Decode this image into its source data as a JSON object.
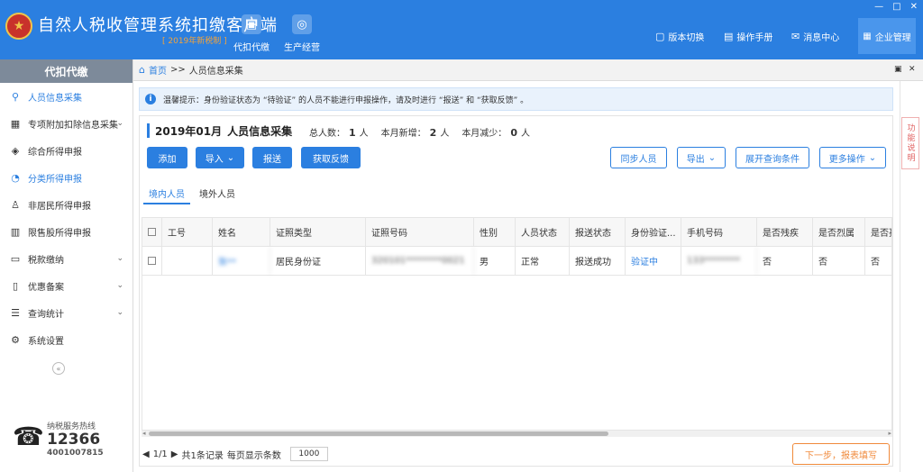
{
  "header": {
    "title": "自然人税收管理系统扣缴客户端",
    "subtitle": "[ 2019年新税制 ]",
    "modules": [
      {
        "label": "代扣代缴",
        "icon": "wallet-icon"
      },
      {
        "label": "生产经营",
        "icon": "coins-icon"
      }
    ],
    "menu": {
      "version": "版本切换",
      "manual": "操作手册",
      "messages": "消息中心",
      "enterprise": "企业管理"
    },
    "window_controls": [
      "—",
      "□",
      "✕"
    ]
  },
  "sidebar": {
    "title": "代扣代缴",
    "items": [
      {
        "label": "人员信息采集",
        "icon": "person-icon",
        "state": "active"
      },
      {
        "label": "专项附加扣除信息采集",
        "icon": "grid-icon",
        "state": "normal",
        "expandable": true
      },
      {
        "label": "综合所得申报",
        "icon": "layers-icon",
        "state": "normal"
      },
      {
        "label": "分类所得申报",
        "icon": "pie-icon",
        "state": "blue"
      },
      {
        "label": "非居民所得申报",
        "icon": "user-icon",
        "state": "normal"
      },
      {
        "label": "限售股所得申报",
        "icon": "bar-chart-icon",
        "state": "normal"
      },
      {
        "label": "税款缴纳",
        "icon": "wallet-icon",
        "state": "normal",
        "expandable": true
      },
      {
        "label": "优惠备案",
        "icon": "document-icon",
        "state": "normal",
        "expandable": true
      },
      {
        "label": "查询统计",
        "icon": "search-list-icon",
        "state": "normal",
        "expandable": true
      },
      {
        "label": "系统设置",
        "icon": "gear-icon",
        "state": "normal"
      }
    ],
    "hotline": {
      "label": "纳税服务热线",
      "number": "12366",
      "alt": "4001007815"
    }
  },
  "breadcrumb": {
    "home": "首页",
    "separator": ">>",
    "current": "人员信息采集"
  },
  "notice": {
    "text": "温馨提示：身份验证状态为 “待验证” 的人员不能进行申报操作，请及时进行 “报送” 和 “获取反馈” 。"
  },
  "side_tab": "功能说明",
  "panel": {
    "period": "2019年01月",
    "title": "人员信息采集",
    "stats": {
      "total_label": "总人数：",
      "total": "1",
      "new_label": "本月新增：",
      "new": "2",
      "reduce_label": "本月减少：",
      "reduce": "0",
      "unit": "人"
    },
    "buttons_left": {
      "add": "添加",
      "import": "导入",
      "submit": "报送",
      "feedback": "获取反馈"
    },
    "buttons_right": {
      "sync": "同步人员",
      "export": "导出",
      "expand": "展开查询条件",
      "more": "更多操作"
    },
    "tabs": [
      "境内人员",
      "境外人员"
    ]
  },
  "table": {
    "columns": [
      "",
      "工号",
      "姓名",
      "证照类型",
      "证照号码",
      "性别",
      "人员状态",
      "报送状态",
      "身份验证...",
      "手机号码",
      "是否残疾",
      "是否烈属",
      "是否孤"
    ],
    "rows": [
      {
        "id": "",
        "name": "张**",
        "doc_type": "居民身份证",
        "doc_no": "320101********0021",
        "gender": "男",
        "person_status": "正常",
        "submit_status": "报送成功",
        "verify": "验证中",
        "phone": "133********",
        "disabled": "否",
        "martyr": "否",
        "orphan": "否"
      }
    ]
  },
  "pager": {
    "page": "1/1",
    "records": "共1条记录",
    "per_page_label": "每页显示条数",
    "per_page": "1000"
  },
  "next_button": "下一步，报表填写",
  "colors": {
    "primary": "#2b7fe0",
    "header_bg": "#2b7fe0",
    "accent_orange": "#f08a3b",
    "sidebar_head": "#7d8a9a"
  }
}
